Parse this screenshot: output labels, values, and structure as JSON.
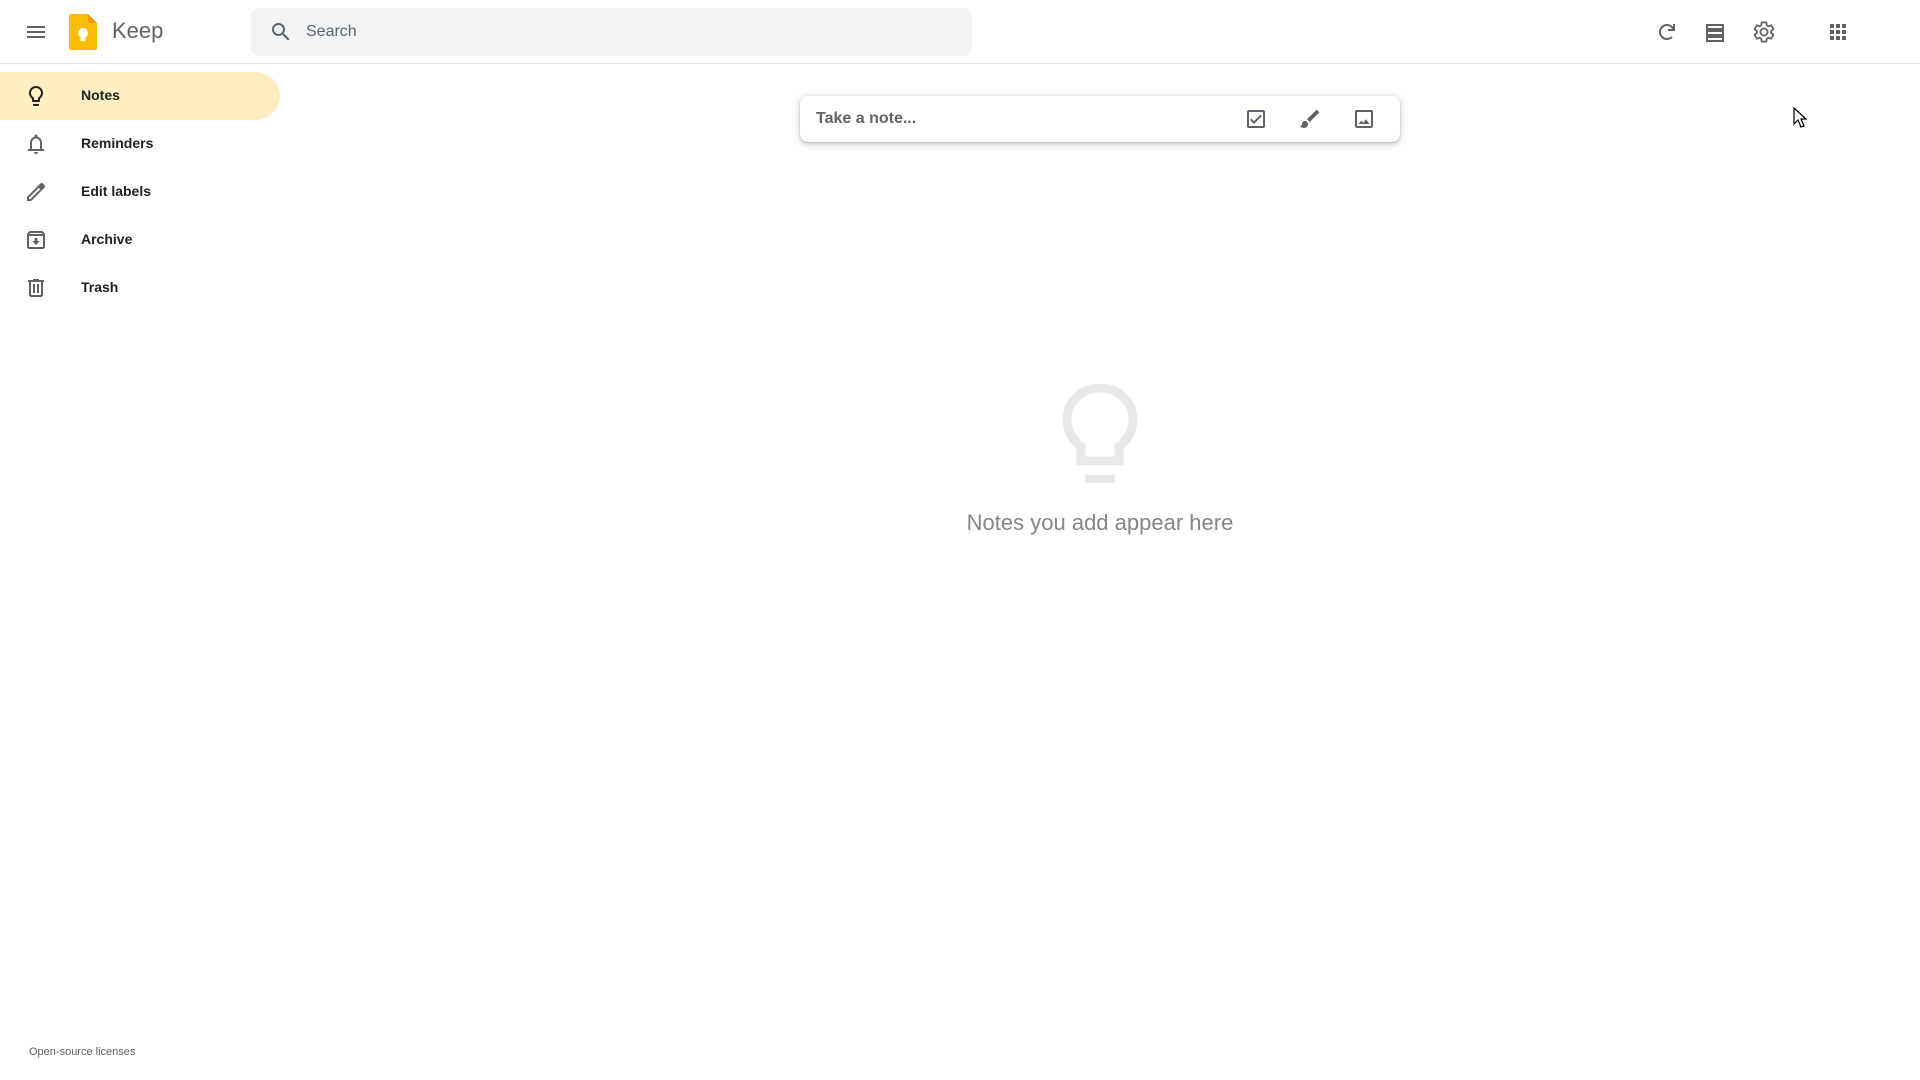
{
  "app": {
    "title": "Keep",
    "brand_color": "#fbbc04",
    "active_bg": "#feefc3"
  },
  "header": {
    "search_placeholder": "Search",
    "icons": [
      "menu-icon",
      "search-icon",
      "refresh-icon",
      "list-view-icon",
      "settings-icon",
      "apps-grid-icon"
    ]
  },
  "sidebar": {
    "items": [
      {
        "label": "Notes",
        "icon": "lightbulb-icon",
        "active": true
      },
      {
        "label": "Reminders",
        "icon": "bell-icon",
        "active": false
      },
      {
        "label": "Edit labels",
        "icon": "pencil-icon",
        "active": false
      },
      {
        "label": "Archive",
        "icon": "archive-icon",
        "active": false
      },
      {
        "label": "Trash",
        "icon": "trash-icon",
        "active": false
      }
    ]
  },
  "composer": {
    "placeholder": "Take a note...",
    "icons": [
      "checkbox-icon",
      "brush-icon",
      "image-icon"
    ]
  },
  "empty_state": {
    "message": "Notes you add appear here",
    "icon": "lightbulb-icon"
  },
  "footer": {
    "link": "Open-source licenses"
  }
}
